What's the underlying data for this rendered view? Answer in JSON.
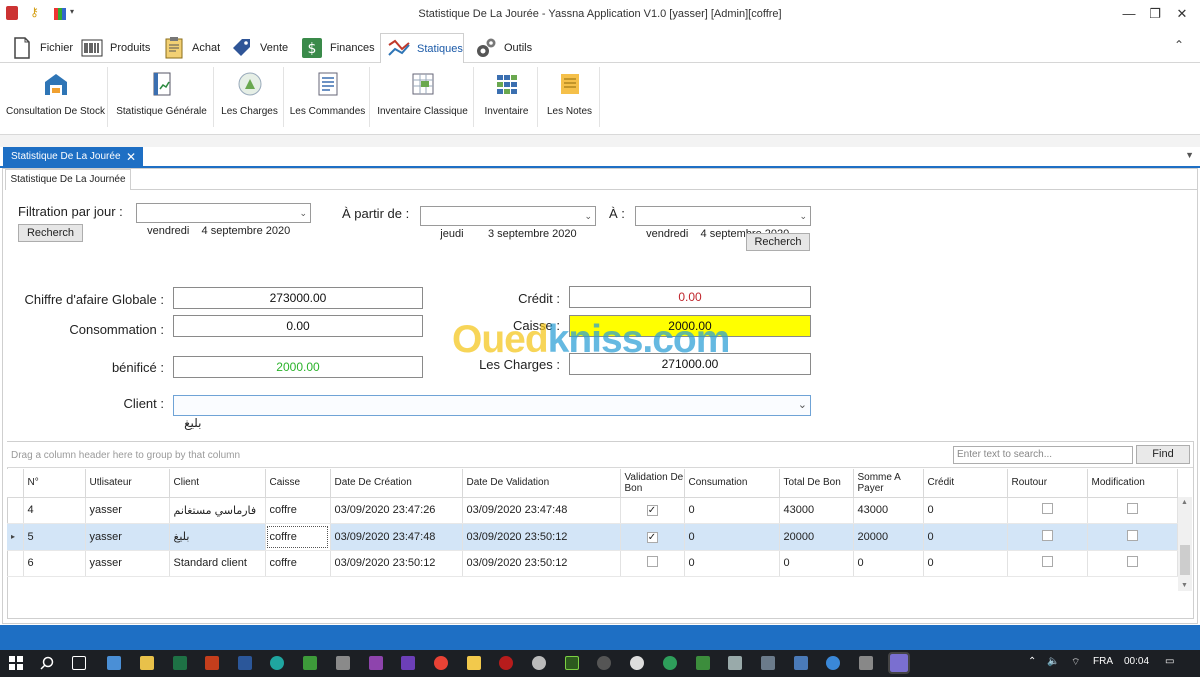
{
  "window": {
    "title": "Statistique De La Jourée - Yassna Application V1.0 [yasser] [Admin][coffre]",
    "controls": {
      "minimize": "—",
      "maximize": "❐",
      "close": "✕"
    }
  },
  "menu": {
    "items": [
      {
        "label": "Fichier",
        "icon": "file-icon"
      },
      {
        "label": "Produits",
        "icon": "barcode-icon"
      },
      {
        "label": "Achat",
        "icon": "clipboard-icon"
      },
      {
        "label": "Vente",
        "icon": "tag-icon"
      },
      {
        "label": "Finances",
        "icon": "dollar-icon"
      },
      {
        "label": "Statiques",
        "icon": "chart-icon",
        "active": true
      },
      {
        "label": "Outils",
        "icon": "gears-icon"
      }
    ],
    "collapse": "⌃"
  },
  "ribbon": {
    "buttons": [
      {
        "label": "Consultation De Stock",
        "icon": "warehouse-icon"
      },
      {
        "label": "Statistique Générale",
        "icon": "report-icon"
      },
      {
        "label": "Les Charges",
        "icon": "bag-icon"
      },
      {
        "label": "Les Commandes",
        "icon": "order-icon"
      },
      {
        "label": "Inventaire Classique",
        "icon": "spreadsheet-icon"
      },
      {
        "label": "Inventaire",
        "icon": "grid-icon"
      },
      {
        "label": "Les Notes",
        "icon": "notes-icon"
      }
    ]
  },
  "doc_tab": {
    "label": "Statistique De La Jourée",
    "close": "✕"
  },
  "sub_tab": {
    "label": "Statistique De La Journée"
  },
  "filter": {
    "day_label": "Filtration par jour :",
    "day_value": "vendredi    4 septembre 2020",
    "from_label": "À partir de :",
    "from_value": "   jeudi        3 septembre 2020",
    "to_label": "À :",
    "to_value": "vendredi    4 septembre 2020",
    "search_label": "Recherch"
  },
  "summary": {
    "ca_label": "Chiffre d'afaire Globale :",
    "ca_value": "273000.00",
    "conso_label": "Consommation :",
    "conso_value": "0.00",
    "benefice_label": "bénificé :",
    "benefice_value": "2000.00",
    "credit_label": "Crédit :",
    "credit_value": "0.00",
    "caisse_label": "Caisse :",
    "caisse_value": "2000.00",
    "charges_label": "Les Charges :",
    "charges_value": "271000.00",
    "client_label": "Client :",
    "client_value": "بليغ"
  },
  "watermark": {
    "part1": "Oued",
    "part2": "kniss",
    "part3": ".com"
  },
  "colors": {
    "accent": "#1e6fc4",
    "benefice": "#2bb32b",
    "credit": "#c0262d",
    "caisse_bg": "#ffff00",
    "selected_row": "#d3e5f7"
  },
  "grid": {
    "group_hint": "Drag a column header here to group by that column",
    "search_placeholder": "Enter text to search...",
    "find_label": "Find",
    "columns": [
      "N°",
      "Utlisateur",
      "Client",
      "Caisse",
      "Date De Création",
      "Date De Validation",
      "Validation De Bon",
      "Consumation",
      "Total De Bon",
      "Somme A Payer",
      "Crédit",
      "Routour",
      "Modification"
    ],
    "rows": [
      {
        "n": "4",
        "user": "yasser",
        "client": "فارماسي مستغانم",
        "caisse": "coffre",
        "created": "03/09/2020 23:47:26",
        "validated": "03/09/2020 23:47:48",
        "validation": true,
        "conso": "0",
        "total": "43000",
        "payer": "43000",
        "credit": "0",
        "retour": false,
        "modif": false
      },
      {
        "n": "5",
        "user": "yasser",
        "client": "بليغ",
        "caisse": "coffre",
        "created": "03/09/2020 23:47:48",
        "validated": "03/09/2020 23:50:12",
        "validation": true,
        "conso": "0",
        "total": "20000",
        "payer": "20000",
        "credit": "0",
        "retour": false,
        "modif": false,
        "selected": true
      },
      {
        "n": "6",
        "user": "yasser",
        "client": "Standard client",
        "caisse": "coffre",
        "created": "03/09/2020 23:50:12",
        "validated": "03/09/2020 23:50:12",
        "validation": false,
        "conso": "0",
        "total": "0",
        "payer": "0",
        "credit": "0",
        "retour": false,
        "modif": false
      }
    ]
  },
  "taskbar": {
    "lang": "FRA",
    "time": "00:04"
  }
}
